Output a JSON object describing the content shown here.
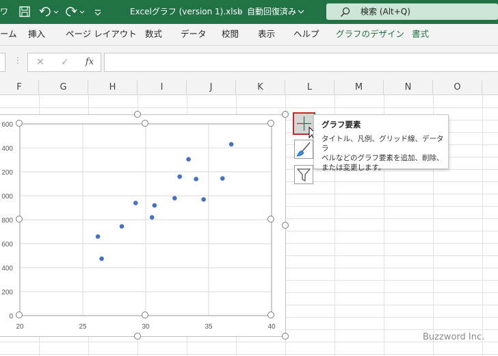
{
  "titlebar": {
    "autosave_fragment": "ワ",
    "filename": "Excelグラフ (version 1).xlsb",
    "separator": "-",
    "status": "自動回復済み",
    "search_label": "検索 (Alt+Q)"
  },
  "ribbon": {
    "tabs": [
      {
        "label": "ーム",
        "contextual": false
      },
      {
        "label": "挿入",
        "contextual": false
      },
      {
        "label": "ページ レイアウト",
        "contextual": false
      },
      {
        "label": "数式",
        "contextual": false
      },
      {
        "label": "データ",
        "contextual": false
      },
      {
        "label": "校閲",
        "contextual": false
      },
      {
        "label": "表示",
        "contextual": false
      },
      {
        "label": "ヘルプ",
        "contextual": false
      },
      {
        "label": "グラフのデザイン",
        "contextual": true
      },
      {
        "label": "書式",
        "contextual": true
      }
    ]
  },
  "formula_bar": {
    "cancel_symbol": "✕",
    "enter_symbol": "✓",
    "fx_label": "fx",
    "more_symbol": "⋮",
    "value": ""
  },
  "columns": [
    "F",
    "G",
    "H",
    "I",
    "J",
    "K",
    "L",
    "M",
    "N",
    "O"
  ],
  "chart_data": {
    "type": "scatter",
    "title": "",
    "xlabel": "",
    "ylabel": "",
    "xlim": [
      20,
      40
    ],
    "ylim": [
      0,
      1600
    ],
    "x_ticks": [
      "20",
      "25",
      "30",
      "35",
      "40"
    ],
    "y_ticks": [
      "0",
      "200",
      "400",
      "600",
      "800",
      "1000",
      "1200",
      "1400",
      "1600"
    ],
    "y_tick_labels_visible": [
      "0",
      "200",
      "400",
      "600",
      "800",
      "000",
      "200",
      "400",
      "600"
    ],
    "grid": true,
    "marker_color": "#4472c4",
    "points": [
      {
        "x": 26.2,
        "y": 660
      },
      {
        "x": 26.5,
        "y": 475
      },
      {
        "x": 28.1,
        "y": 745
      },
      {
        "x": 29.2,
        "y": 940
      },
      {
        "x": 30.5,
        "y": 820
      },
      {
        "x": 30.7,
        "y": 920
      },
      {
        "x": 32.3,
        "y": 980
      },
      {
        "x": 32.7,
        "y": 1160
      },
      {
        "x": 33.4,
        "y": 1305
      },
      {
        "x": 34.0,
        "y": 1140
      },
      {
        "x": 34.6,
        "y": 970
      },
      {
        "x": 36.1,
        "y": 1145
      },
      {
        "x": 36.8,
        "y": 1430
      }
    ]
  },
  "chart_buttons": {
    "elements_icon": "plus-icon",
    "styles_icon": "paintbrush-icon",
    "filter_icon": "funnel-icon"
  },
  "tooltip": {
    "title": "グラフ要素",
    "lines": [
      "タイトル、凡例、グリッド線、データ ラ",
      "ベルなどのグラフ要素を追加、削除、",
      "または変更します。"
    ]
  },
  "watermark": "Buzzword Inc."
}
